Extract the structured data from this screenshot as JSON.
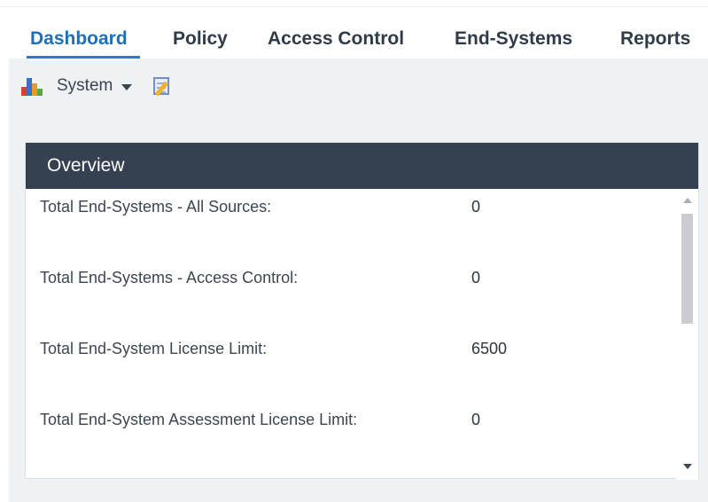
{
  "tabs": [
    {
      "label": "Dashboard",
      "active": true
    },
    {
      "label": "Policy",
      "active": false
    },
    {
      "label": "Access Control",
      "active": false
    },
    {
      "label": "End-Systems",
      "active": false
    },
    {
      "label": "Reports",
      "active": false
    }
  ],
  "toolbar": {
    "chart_icon": "bar-chart-icon",
    "view_label": "System",
    "dropdown_icon": "caret-down-icon",
    "edit_icon": "edit-notes-icon"
  },
  "overview": {
    "title": "Overview",
    "rows": [
      {
        "label": "Total End-Systems - All Sources:",
        "value": "0"
      },
      {
        "label": "Total End-Systems - Access Control:",
        "value": "0"
      },
      {
        "label": "Total End-System License Limit:",
        "value": "6500"
      },
      {
        "label": "Total End-System Assessment License Limit:",
        "value": "0"
      }
    ]
  },
  "colors": {
    "active_tab": "#1f6fb8",
    "tab_underline": "#2a7ac7",
    "header_bg": "#354150",
    "workspace_bg": "#eef2f4"
  }
}
